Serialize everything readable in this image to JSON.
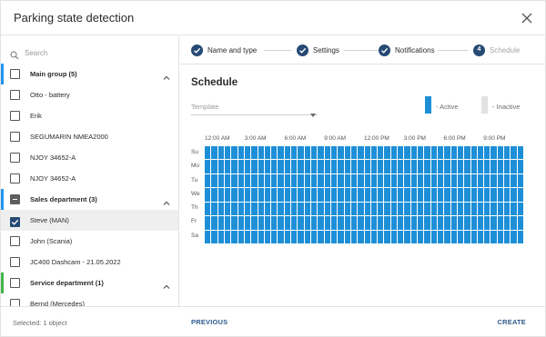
{
  "dialog": {
    "title": "Parking state detection"
  },
  "search": {
    "placeholder": "Search"
  },
  "tree": [
    {
      "label": "Main group (5)",
      "kind": "group",
      "checkbox": "unchecked",
      "bar_color": "#2196f3",
      "expanded": true
    },
    {
      "label": "Otto - battery",
      "kind": "item",
      "checkbox": "unchecked"
    },
    {
      "label": "Erik",
      "kind": "item",
      "checkbox": "unchecked"
    },
    {
      "label": "SEGUMARIN NMEA2000",
      "kind": "item",
      "checkbox": "unchecked"
    },
    {
      "label": "NJOY 34652-A",
      "kind": "item",
      "checkbox": "unchecked"
    },
    {
      "label": "NJOY 34652-A",
      "kind": "item",
      "checkbox": "unchecked"
    },
    {
      "label": "Sales department (3)",
      "kind": "group",
      "checkbox": "partial",
      "bar_color": "#2196f3",
      "expanded": true
    },
    {
      "label": "Steve (MAN)",
      "kind": "item",
      "checkbox": "checked",
      "selected": true
    },
    {
      "label": "John (Scania)",
      "kind": "item",
      "checkbox": "unchecked"
    },
    {
      "label": "JC400 Dashcam - 21.05.2022",
      "kind": "item",
      "checkbox": "unchecked"
    },
    {
      "label": "Service department (1)",
      "kind": "group",
      "checkbox": "unchecked",
      "bar_color": "#43b549",
      "expanded": true
    },
    {
      "label": "Bernd (Mercedes)",
      "kind": "item",
      "checkbox": "unchecked"
    }
  ],
  "steps": [
    {
      "label": "Name and type",
      "state": "done"
    },
    {
      "label": "Settings",
      "state": "done"
    },
    {
      "label": "Notifications",
      "state": "done"
    },
    {
      "label": "Schedule",
      "number": "4",
      "state": "current"
    }
  ],
  "schedule": {
    "title": "Schedule",
    "template_placeholder": "Template",
    "legend_active": "- Active",
    "legend_inactive": "- Inactive",
    "active_color": "#1e8fd7",
    "inactive_color": "#e2e2e2",
    "time_labels": [
      "12:00 AM",
      "3:00 AM",
      "6:00 AM",
      "9:00 AM",
      "12:00 PM",
      "3:00 PM",
      "6:00 PM",
      "9:00 PM"
    ],
    "days": [
      "Su",
      "Mo",
      "Tu",
      "We",
      "Th",
      "Fr",
      "Sa"
    ],
    "slots_per_day": 48,
    "all_active": true
  },
  "footer": {
    "selected_text": "Selected: 1 object",
    "previous_label": "PREVIOUS",
    "create_label": "CREATE"
  },
  "colors": {
    "accent": "#264a74",
    "button_text": "#2d5b8c"
  }
}
